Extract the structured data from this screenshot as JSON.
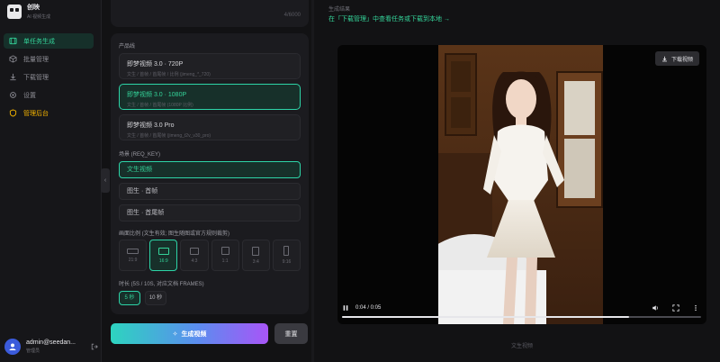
{
  "brand": {
    "name": "创映",
    "subtitle": "AI 视频生成"
  },
  "nav": {
    "items": [
      {
        "label": "单任务生成",
        "icon": "film-icon",
        "active": true
      },
      {
        "label": "批量管理",
        "icon": "cube-icon",
        "active": false
      },
      {
        "label": "下载管理",
        "icon": "download-icon",
        "active": false
      },
      {
        "label": "设置",
        "icon": "gear-icon",
        "active": false
      },
      {
        "label": "管理后台",
        "icon": "shield-icon",
        "active": false
      }
    ]
  },
  "user": {
    "name": "admin@seedan...",
    "role": "管理员"
  },
  "form": {
    "char_count": "4/6000",
    "model_label": "产品线",
    "models": [
      {
        "title": "即梦视频 3.0 · 720P",
        "desc": "文生 / 首帧 / 首尾帧 / 比例 (jimeng_*_720)",
        "selected": false
      },
      {
        "title": "即梦视频 3.0 · 1080P",
        "desc": "文生 / 首帧 / 首尾帧 (1080P 比例)",
        "selected": true
      },
      {
        "title": "即梦视频 3.0 Pro",
        "desc": "文生 / 首帧 / 首尾帧 (jimeng_t2v_v30_pro)",
        "selected": false
      }
    ],
    "scene_label": "场景 (REQ_KEY)",
    "scenes": [
      {
        "label": "文生视频",
        "selected": true
      },
      {
        "label": "图生 · 首帧",
        "selected": false
      },
      {
        "label": "图生 · 首尾帧",
        "selected": false
      }
    ],
    "ratio_label": "画面比例 (文生有效; 图生随图或官方规则裁剪)",
    "ratios": [
      {
        "label": "21:9",
        "selected": false
      },
      {
        "label": "16:9",
        "selected": true
      },
      {
        "label": "4:3",
        "selected": false
      },
      {
        "label": "1:1",
        "selected": false
      },
      {
        "label": "3:4",
        "selected": false
      },
      {
        "label": "9:16",
        "selected": false
      }
    ],
    "duration_label": "时长 (5S / 10S, 对应文档 FRAMES)",
    "durations": [
      {
        "label": "5 秒",
        "selected": true
      },
      {
        "label": "10 秒",
        "selected": false
      }
    ],
    "generate_label": "生成视频",
    "reset_label": "重置"
  },
  "result": {
    "title": "生成结果",
    "tip": "在「下载管理」中查看任务或下载到本地 →",
    "download_label": "下载视频",
    "time": "0:04 / 0:05",
    "progress": 0.8,
    "caption": "文生视频"
  }
}
